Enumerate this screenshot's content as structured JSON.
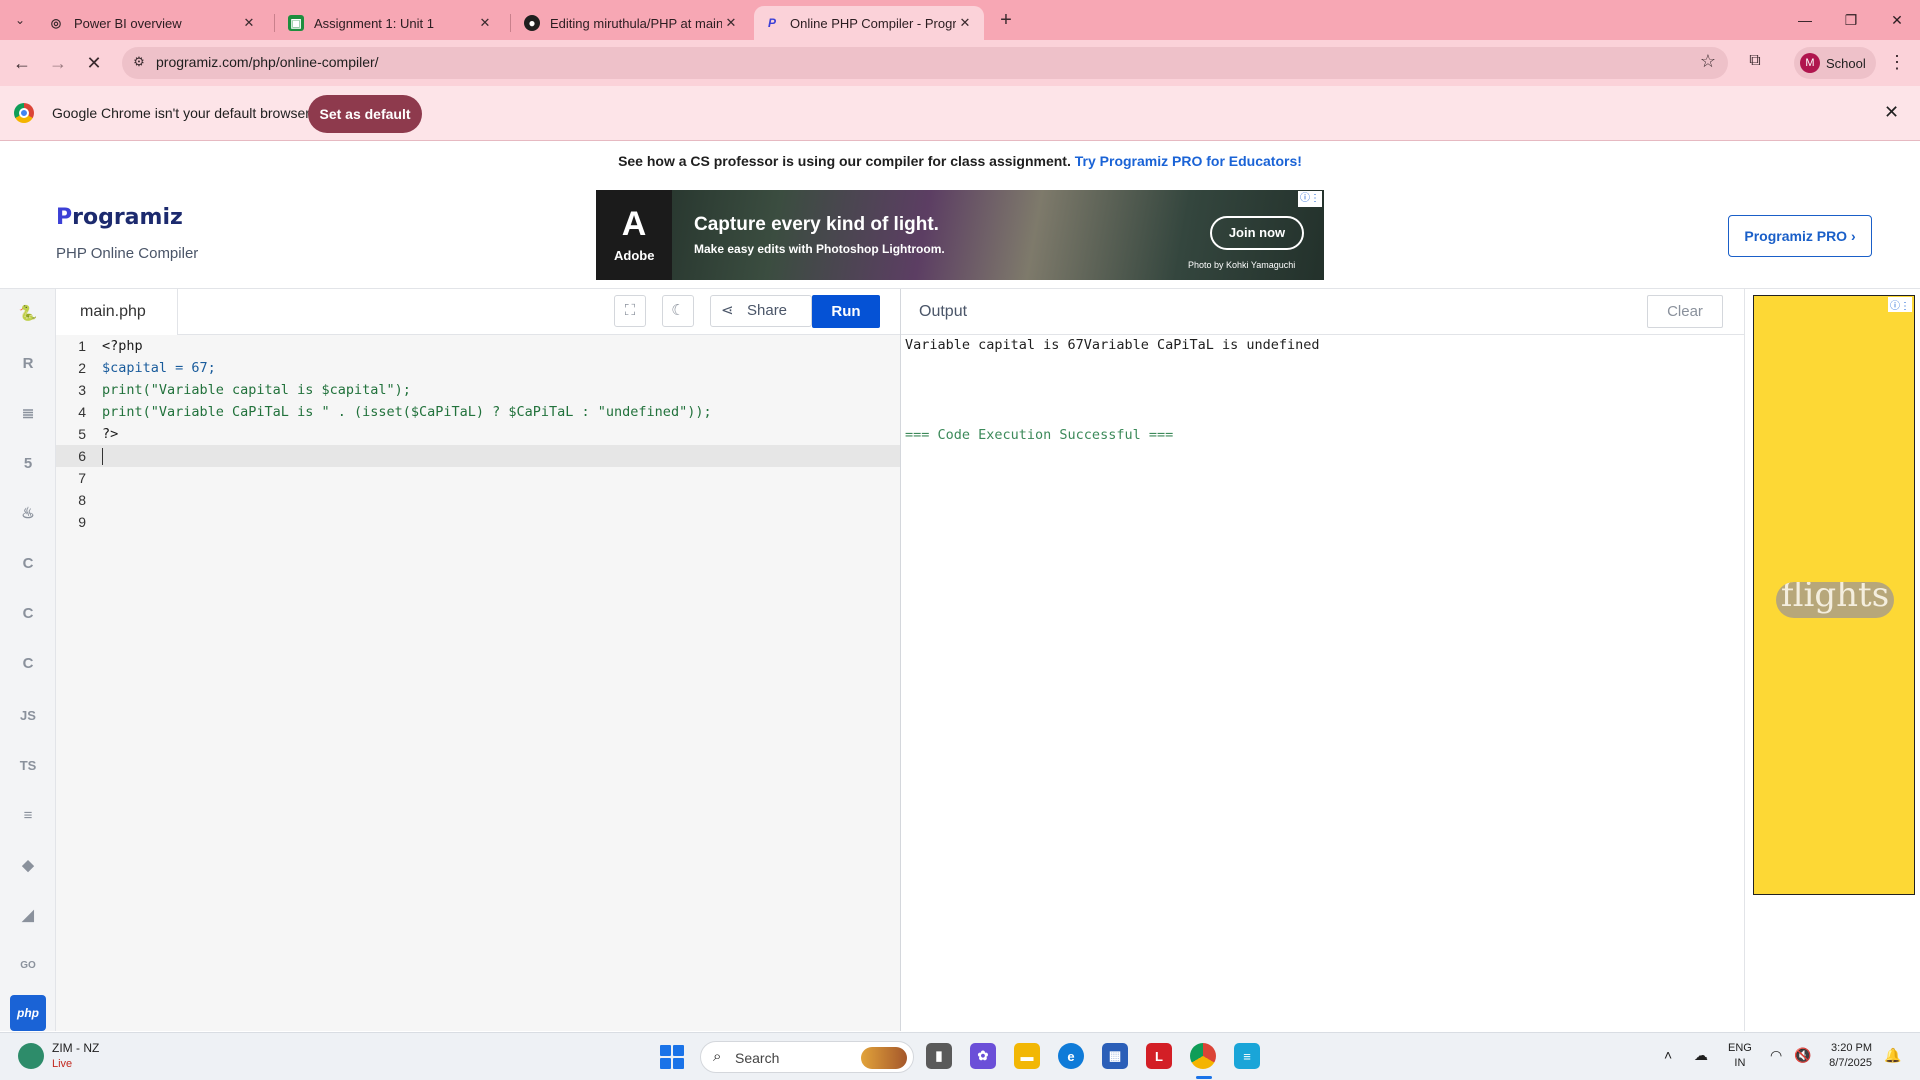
{
  "browser": {
    "tabs": [
      {
        "title": "Power BI overview",
        "icon": "globe-icon",
        "active": false
      },
      {
        "title": "Assignment 1: Unit 1",
        "icon": "classroom-icon",
        "active": false
      },
      {
        "title": "Editing miruthula/PHP at main",
        "icon": "github-icon",
        "active": false
      },
      {
        "title": "Online PHP Compiler - Programiz",
        "icon": "programiz-icon",
        "active": true
      }
    ],
    "url": "programiz.com/php/online-compiler/",
    "profile_initial": "M",
    "profile_name": "School",
    "infobar_text": "Google Chrome isn't your default browser",
    "infobar_button": "Set as default"
  },
  "page": {
    "promo_text": "See how a CS professor is using our compiler for class assignment.",
    "promo_link": "Try Programiz PRO for Educators!",
    "logo_text": "rogramiz",
    "logo_initial": "P",
    "logo_sub": "PHP Online Compiler",
    "pro_button": "Programiz PRO ›",
    "ad": {
      "brand": "Adobe",
      "headline": "Capture every kind of light.",
      "sub": "Make easy edits with Photoshop Lightroom.",
      "cta": "Join now",
      "credit": "Photo by Kohki Yamaguchi"
    },
    "side_ad_text": "flights"
  },
  "sidebar": {
    "languages": [
      {
        "name": "python",
        "glyph": "🐍",
        "active": false
      },
      {
        "name": "r",
        "glyph": "R",
        "active": false
      },
      {
        "name": "sql",
        "glyph": "≣",
        "active": false
      },
      {
        "name": "html",
        "glyph": "5",
        "active": false
      },
      {
        "name": "java",
        "glyph": "♨",
        "active": false
      },
      {
        "name": "c",
        "glyph": "C",
        "active": false
      },
      {
        "name": "cpp",
        "glyph": "C",
        "active": false
      },
      {
        "name": "csharp",
        "glyph": "C",
        "active": false
      },
      {
        "name": "javascript",
        "glyph": "JS",
        "active": false
      },
      {
        "name": "typescript",
        "glyph": "TS",
        "active": false
      },
      {
        "name": "ruby-go-stack",
        "glyph": "≡",
        "active": false
      },
      {
        "name": "swift",
        "glyph": "◆",
        "active": false
      },
      {
        "name": "kotlin",
        "glyph": "◢",
        "active": false
      },
      {
        "name": "go",
        "glyph": "GO",
        "active": false
      },
      {
        "name": "php",
        "glyph": "php",
        "active": true
      }
    ]
  },
  "editor": {
    "filename": "main.php",
    "share_label": "Share",
    "run_label": "Run",
    "line_numbers": [
      "1",
      "2",
      "3",
      "4",
      "5",
      "6",
      "7",
      "8",
      "9"
    ],
    "lines": [
      "<?php",
      "$capital = 67;",
      "print(\"Variable capital is $capital\");",
      "print(\"Variable CaPiTaL is \" . (isset($CaPiTaL) ? $CaPiTaL : \"undefined\"));",
      "?>",
      "",
      "",
      "",
      ""
    ],
    "current_line": 6
  },
  "output": {
    "title": "Output",
    "clear_label": "Clear",
    "result": "Variable capital is 67Variable CaPiTaL is undefined",
    "status": "=== Code Execution Successful ==="
  },
  "taskbar": {
    "weather_title": "ZIM - NZ",
    "weather_sub": "Live",
    "search_placeholder": "Search",
    "lang_top": "ENG",
    "lang_bottom": "IN",
    "time": "3:20 PM",
    "date": "8/7/2025"
  },
  "colors": {
    "tabstrip": "#f7a7b4",
    "run_button": "#0552d5",
    "active_language": "#1a63d6",
    "side_ad": "#fdd835"
  }
}
